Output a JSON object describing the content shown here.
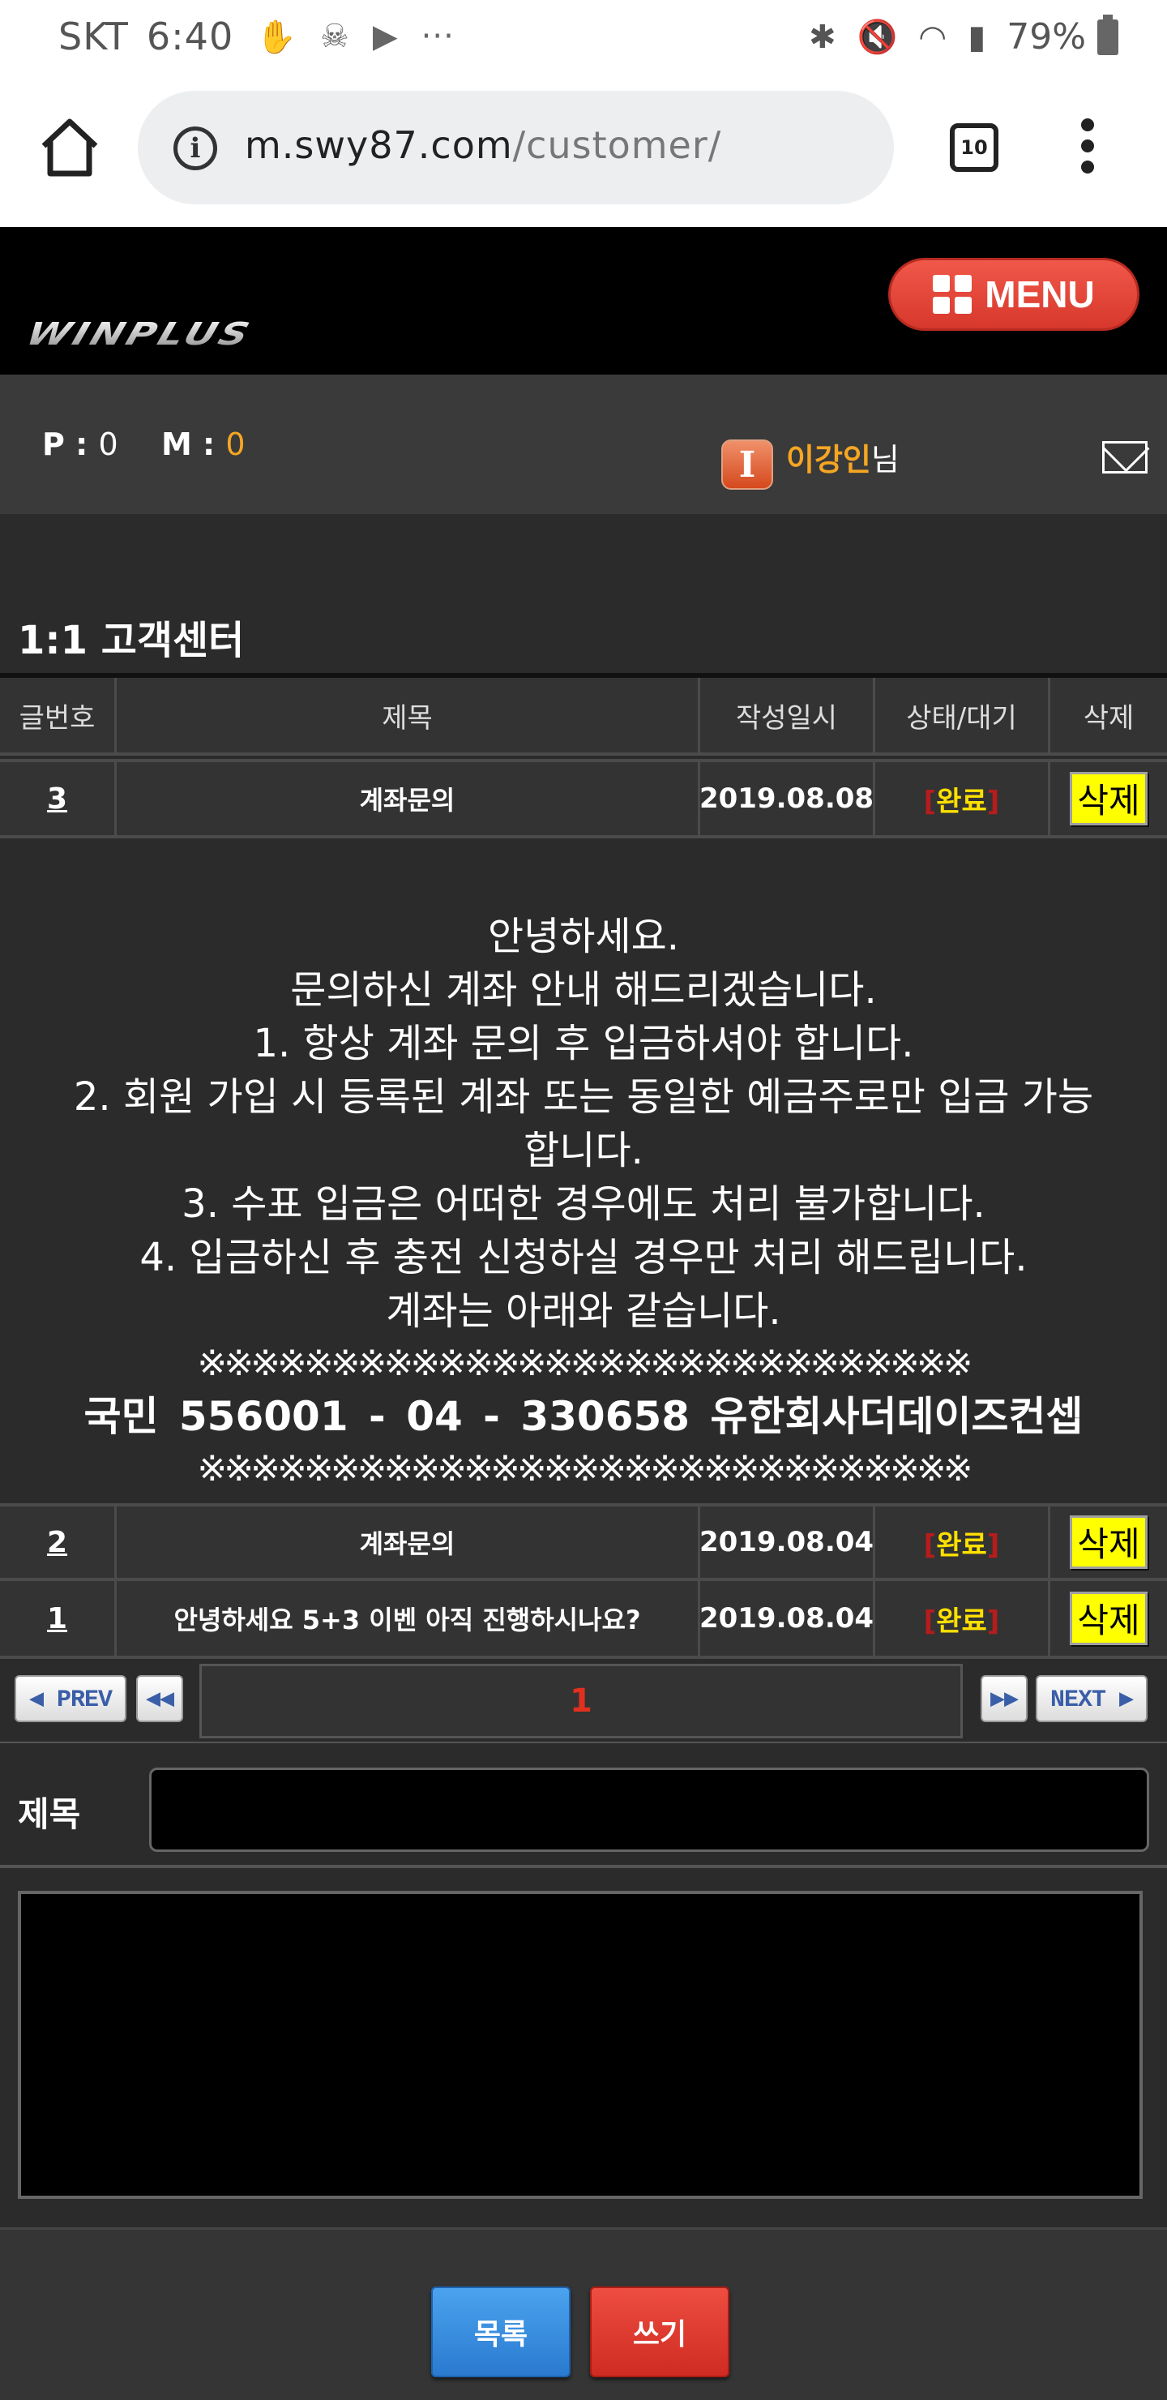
{
  "statusbar": {
    "carrier": "SKT",
    "time": "6:40",
    "battery": "79%",
    "notification_icons": [
      "hand-icon",
      "skull-icon",
      "youtube-icon",
      "more-dots-icon"
    ],
    "system_icons": [
      "bluetooth-icon",
      "mute-icon",
      "wifi-icon",
      "signal-icon",
      "battery-icon"
    ]
  },
  "browser": {
    "url_host": "m.swy87.com",
    "url_path": "/customer/",
    "tab_count": "10"
  },
  "header": {
    "logo": "WINPLUS",
    "menu_label": "MENU"
  },
  "userbar": {
    "p_label": "P :",
    "p_value": "0",
    "m_label": "M :",
    "m_value": "0",
    "username": "이강인",
    "username_suffix": "님"
  },
  "page": {
    "title": "1:1 고객센터"
  },
  "table": {
    "headers": [
      "글번호",
      "제목",
      "작성일시",
      "상태/대기",
      "삭제"
    ],
    "rows": [
      {
        "num": "3",
        "subject": "계좌문의",
        "date": "2019.08.08",
        "status": "완료",
        "delete": "삭제"
      },
      {
        "num": "2",
        "subject": "계좌문의",
        "date": "2019.08.04",
        "status": "완료",
        "delete": "삭제"
      },
      {
        "num": "1",
        "subject": "안녕하세요 5+3 이벤 아직 진행하시나요?",
        "date": "2019.08.04",
        "status": "완료",
        "delete": "삭제"
      }
    ]
  },
  "answer": {
    "lines": [
      "안녕하세요.",
      "문의하신 계좌 안내 해드리겠습니다.",
      "1. 항상 계좌 문의 후 입금하셔야 합니다.",
      "2. 회원 가입 시 등록된 계좌 또는 동일한 예금주로만 입금 가능",
      "합니다.",
      "3. 수표 입금은 어떠한 경우에도 처리 불가합니다.",
      "4. 입금하신 후 충전 신청하실 경우만 처리 해드립니다.",
      "계좌는 아래와 같습니다."
    ],
    "stars_top": "※※※※※※※※※※※※※※※※※※※※※※※※※※※※※",
    "account": "국민   556001  -  04  -  330658  유한회사더데이즈컨셉",
    "stars_bottom": "※※※※※※※※※※※※※※※※※※※※※※※※※※※※※"
  },
  "pager": {
    "prev": "◀ PREV",
    "first": "◀◀",
    "current_page": "1",
    "last": "▶▶",
    "next": "NEXT ▶"
  },
  "form": {
    "title_label": "제목",
    "title_value": "",
    "content_value": "",
    "list_button": "목록",
    "write_button": "쓰기"
  },
  "colors": {
    "accent_orange": "#f5a623",
    "status_yellow": "#ffe000",
    "page_number_red": "#e0301e",
    "menu_red": "#e0473a",
    "list_blue": "#3a8de0"
  }
}
